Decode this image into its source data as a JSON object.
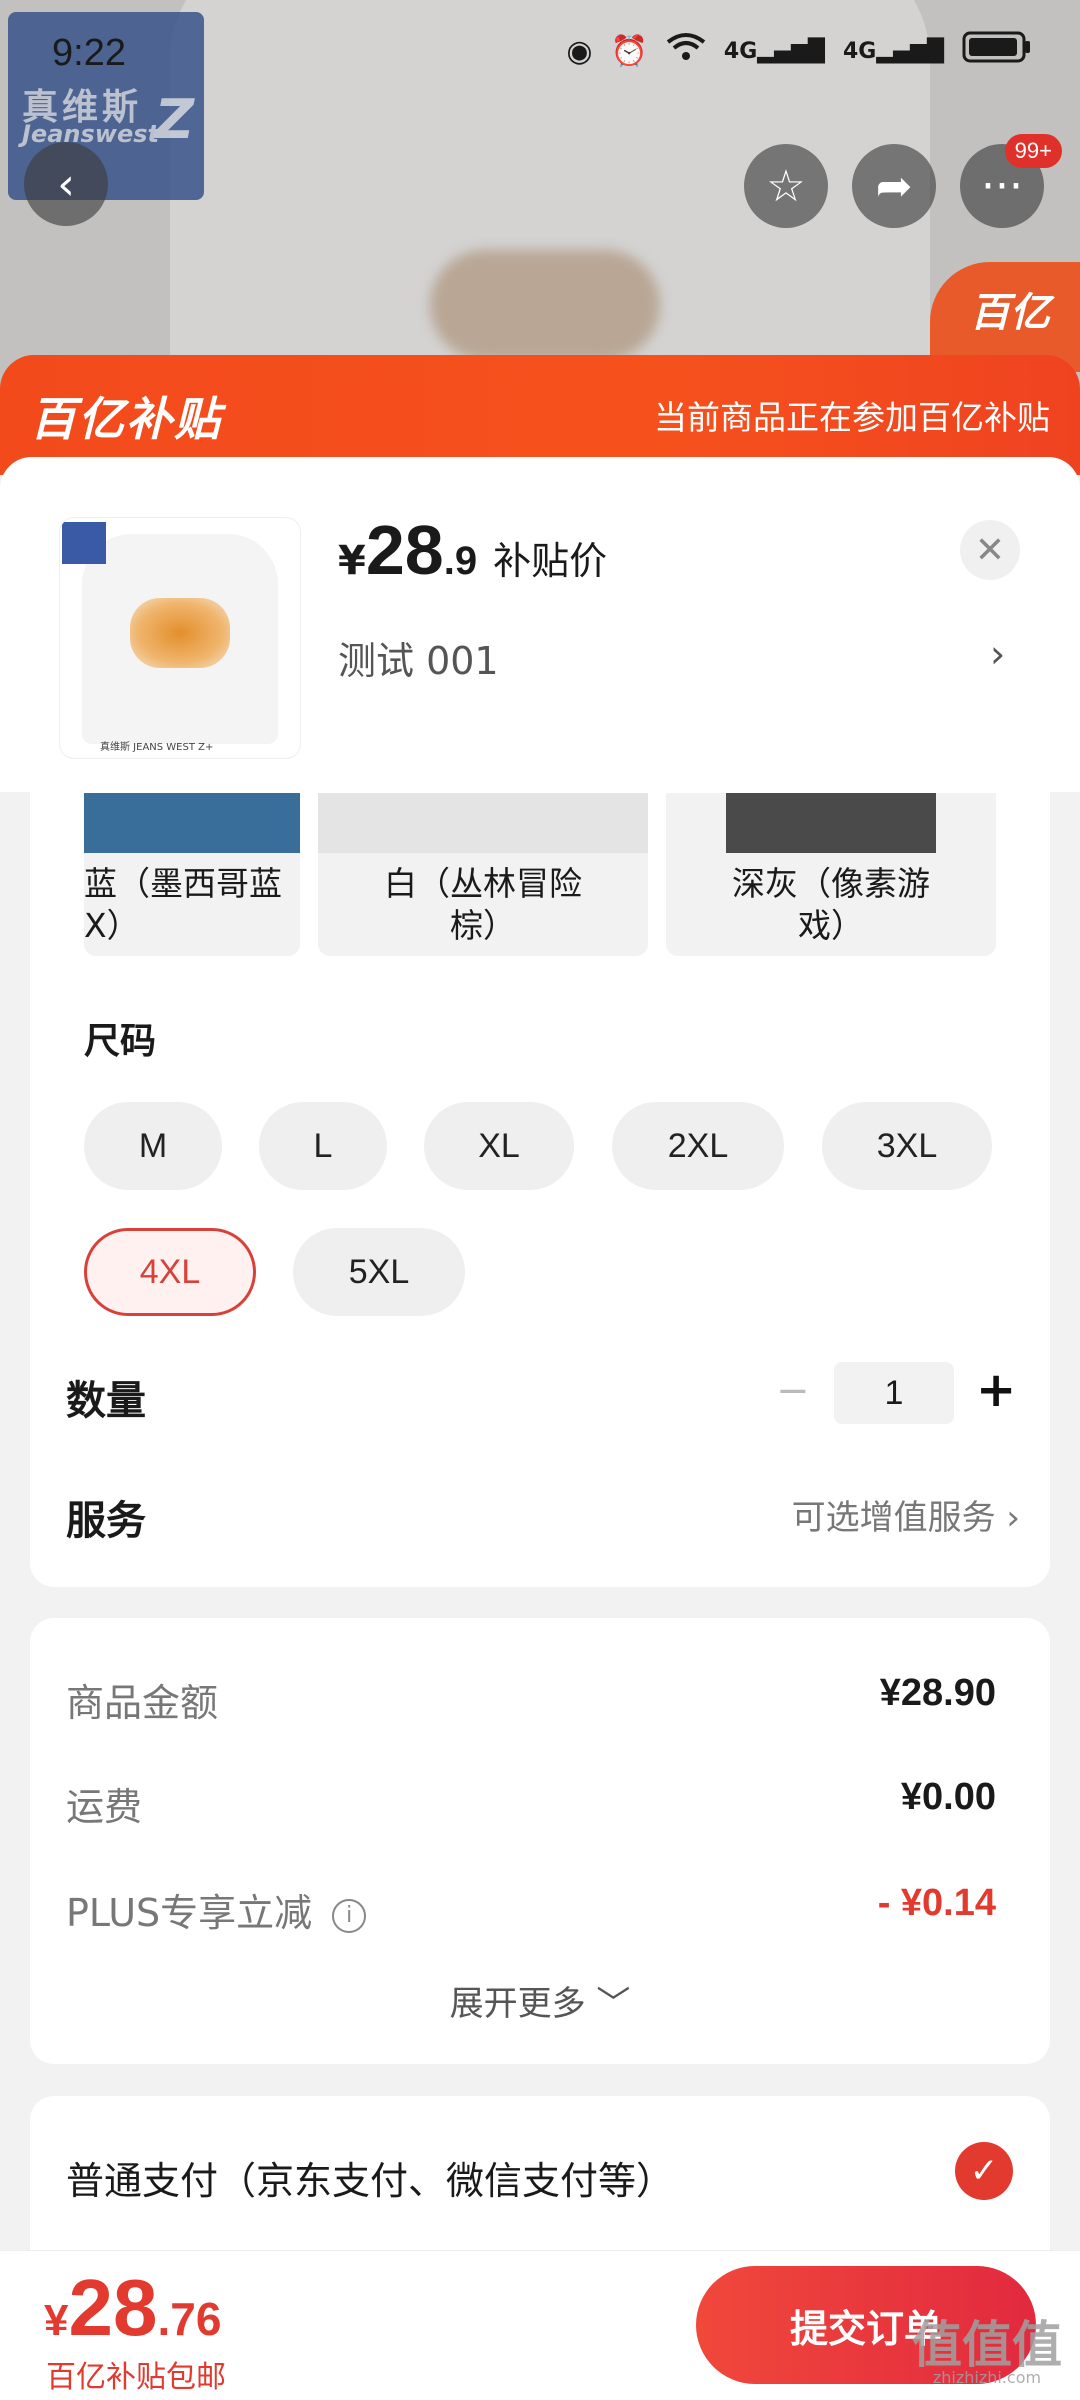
{
  "status_bar": {
    "time": "9:22",
    "icons": [
      "eye-icon",
      "alarm-icon",
      "wifi-icon",
      "signal-4g-icon",
      "signal-4g-icon",
      "battery-icon"
    ]
  },
  "background_page": {
    "brand_cn": "真维斯",
    "brand_en": "Jeanswest",
    "brand_mark": "Z",
    "corner_badge": "百亿",
    "more_badge": "99+"
  },
  "banner": {
    "logo": "百亿补贴",
    "tip": "当前商品正在参加百亿补贴"
  },
  "product": {
    "yen": "¥",
    "price_int": "28",
    "price_dec": ".9",
    "price_tag": "补贴价",
    "variant": "测试  001",
    "thumb_caption": "真维斯 JEANS WEST Z+"
  },
  "colors": [
    {
      "label": "蓝（墨西哥蓝X）",
      "swatch": "#3a6e9a"
    },
    {
      "label": "白（丛林冒险棕）",
      "swatch": "#ececec"
    },
    {
      "label": "深灰（像素游戏）",
      "swatch": "#4a4a4a"
    }
  ],
  "sizes": {
    "title": "尺码",
    "options": [
      "M",
      "L",
      "XL",
      "2XL",
      "3XL",
      "4XL",
      "5XL"
    ],
    "selected": "4XL"
  },
  "quantity": {
    "label": "数量",
    "minus": "−",
    "value": "1",
    "plus": "+"
  },
  "service": {
    "label": "服务",
    "hint": "可选增值服务 ›"
  },
  "amounts": {
    "goods_label": "商品金额",
    "goods_value": "¥28.90",
    "shipping_label": "运费",
    "shipping_value": "¥0.00",
    "plus_label": "PLUS专享立减",
    "plus_value": "- ¥0.14",
    "expand": "展开更多 ﹀"
  },
  "payment": {
    "label": "普通支付（京东支付、微信支付等）"
  },
  "footer": {
    "yen": "¥",
    "total_int": "28",
    "total_dec": ".76",
    "note": "百亿补贴包邮",
    "submit": "提交订单",
    "watermark": "值值值",
    "watermark_url": "zhizhizhi.com"
  },
  "colors_theme": {
    "accent": "#e23a2f",
    "banner": "#f34a1c"
  }
}
